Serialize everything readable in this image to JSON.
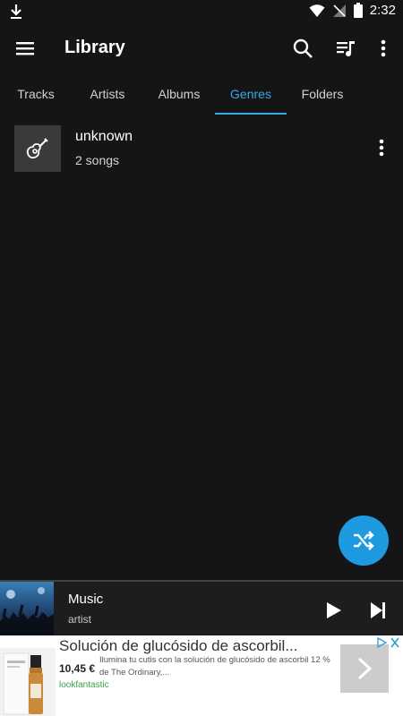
{
  "status_bar": {
    "time": "2:32"
  },
  "app_bar": {
    "title": "Library"
  },
  "tabs": [
    {
      "label": "Tracks",
      "active": false
    },
    {
      "label": "Artists",
      "active": false
    },
    {
      "label": "Albums",
      "active": false
    },
    {
      "label": "Genres",
      "active": true
    },
    {
      "label": "Folders",
      "active": false
    }
  ],
  "genres": [
    {
      "name": "unknown",
      "count": "2 songs",
      "icon": "guitar-icon"
    }
  ],
  "now_playing": {
    "title": "Music",
    "artist": "artist"
  },
  "ad": {
    "headline": "Solución de glucósido de ascorbil...",
    "price": "10,45 €",
    "description": "Ilumina tu cutis con la solución de glucósido de ascorbil 12 % de The Ordinary,...",
    "brand": "lookfantastic"
  },
  "colors": {
    "background": "#151517",
    "accent": "#35a9e6",
    "fab": "#1e9be0",
    "player": "#1d1d1f"
  }
}
